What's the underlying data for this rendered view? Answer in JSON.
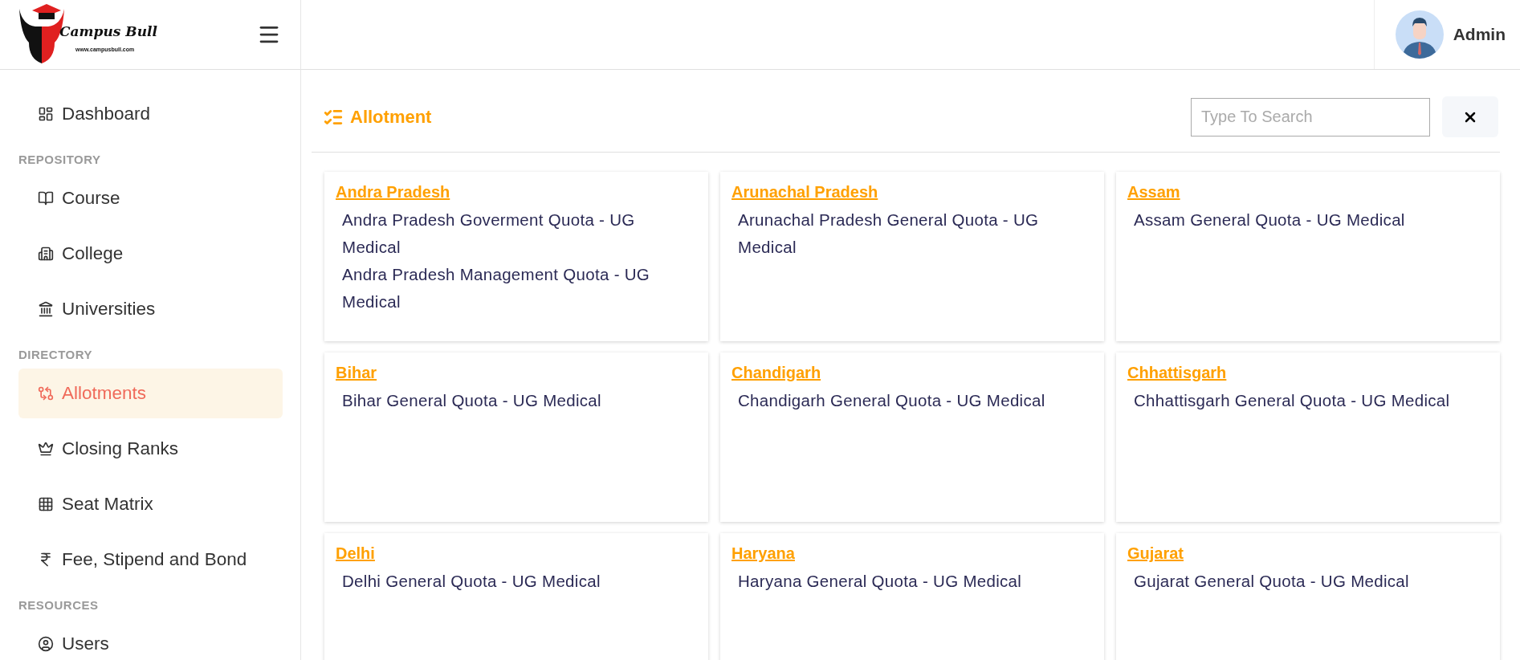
{
  "logo": {
    "name": "Campus Bull",
    "url": "www.campusbull.com"
  },
  "user": {
    "name": "Admin"
  },
  "sidebar": {
    "sections": [
      {
        "items": [
          {
            "label": "Dashboard",
            "selected": false
          }
        ]
      },
      {
        "heading": "REPOSITORY",
        "items": [
          {
            "label": "Course",
            "selected": false
          },
          {
            "label": "College",
            "selected": false
          },
          {
            "label": "Universities",
            "selected": false
          }
        ]
      },
      {
        "heading": "DIRECTORY",
        "items": [
          {
            "label": "Allotments",
            "selected": true
          },
          {
            "label": "Closing Ranks",
            "selected": false
          },
          {
            "label": "Seat Matrix",
            "selected": false
          },
          {
            "label": "Fee, Stipend and Bond",
            "selected": false
          }
        ]
      },
      {
        "heading": "RESOURCES",
        "items": [
          {
            "label": "Users",
            "selected": false
          }
        ]
      }
    ]
  },
  "page": {
    "title": "Allotment",
    "search": {
      "placeholder": "Type To Search"
    }
  },
  "cards": [
    {
      "title": "Andra Pradesh",
      "items": [
        "Andra Pradesh Goverment Quota - UG Medical",
        "Andra Pradesh Management Quota - UG Medical"
      ]
    },
    {
      "title": "Arunachal Pradesh",
      "items": [
        "Arunachal Pradesh General Quota - UG Medical"
      ]
    },
    {
      "title": "Assam",
      "items": [
        "Assam General Quota - UG Medical"
      ]
    },
    {
      "title": "Bihar",
      "items": [
        "Bihar General Quota - UG Medical"
      ]
    },
    {
      "title": "Chandigarh",
      "items": [
        "Chandigarh General Quota - UG Medical"
      ]
    },
    {
      "title": "Chhattisgarh",
      "items": [
        "Chhattisgarh General Quota - UG Medical"
      ]
    },
    {
      "title": "Delhi",
      "items": [
        "Delhi General Quota - UG Medical"
      ]
    },
    {
      "title": "Haryana",
      "items": [
        "Haryana General Quota - UG Medical"
      ]
    },
    {
      "title": "Gujarat",
      "items": [
        "Gujarat General Quota - UG Medical"
      ]
    }
  ]
}
